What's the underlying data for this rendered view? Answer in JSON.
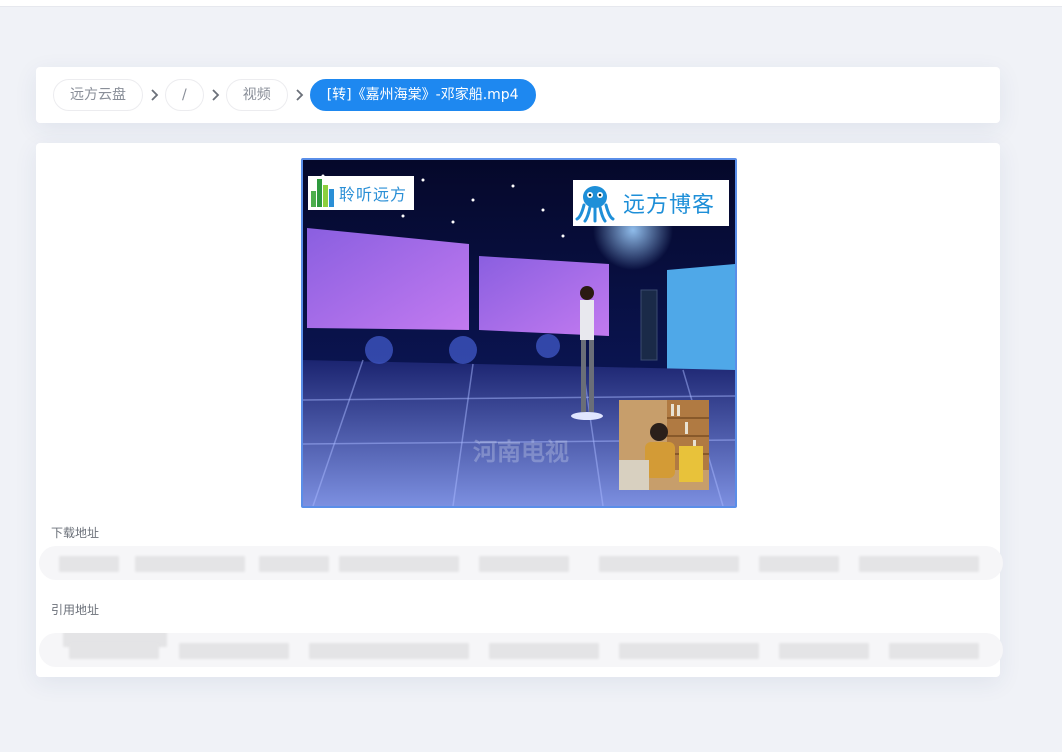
{
  "breadcrumb": {
    "items": [
      "远方云盘",
      "/",
      "视频"
    ],
    "current": "[转]《嘉州海棠》-邓家船.mp4"
  },
  "video": {
    "logo_left_text": "聆听远方",
    "logo_right_text": "远方博客",
    "watermark_text": "河南电视"
  },
  "download": {
    "label": "下载地址",
    "value": ""
  },
  "reference": {
    "label": "引用地址",
    "value": ""
  },
  "colors": {
    "accent": "#1e88f0",
    "background": "#f0f2f7"
  }
}
